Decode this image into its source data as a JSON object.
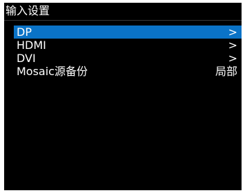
{
  "title": "输入设置",
  "colors": {
    "background": "#000000",
    "selected_bg": "#0a73c7",
    "text": "#ffffff"
  },
  "menu": {
    "items": [
      {
        "label": "DP",
        "value": ">",
        "selected": true
      },
      {
        "label": "HDMI",
        "value": ">",
        "selected": false
      },
      {
        "label": "DVI",
        "value": ">",
        "selected": false
      },
      {
        "label": "Mosaic源备份",
        "value": "局部",
        "selected": false
      }
    ]
  }
}
